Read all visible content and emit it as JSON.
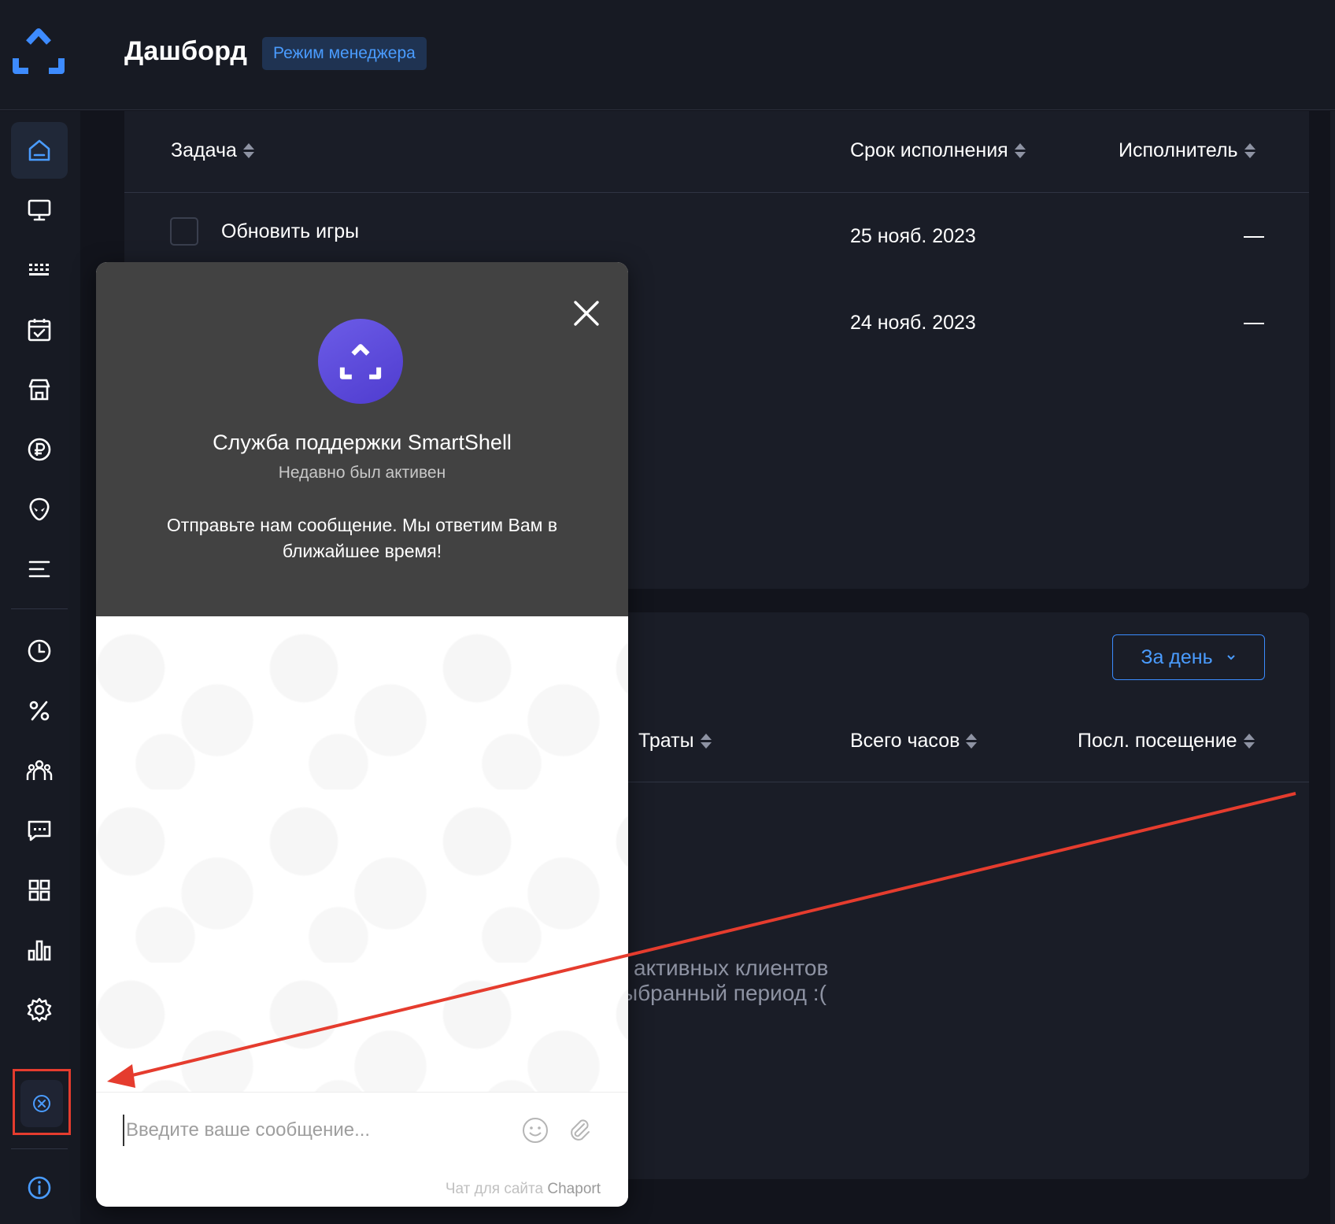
{
  "header": {
    "title": "Дашборд",
    "mode_badge": "Режим менеджера"
  },
  "sidebar": {
    "items": [
      {
        "icon": "home-icon",
        "active": true
      },
      {
        "icon": "monitor-icon"
      },
      {
        "icon": "keyboard-icon"
      },
      {
        "icon": "calendar-check-icon"
      },
      {
        "icon": "store-icon"
      },
      {
        "icon": "ruble-icon"
      },
      {
        "icon": "alien-icon"
      },
      {
        "icon": "menu-lines-icon"
      },
      {
        "icon": "clock-icon"
      },
      {
        "icon": "percent-icon"
      },
      {
        "icon": "users-icon"
      },
      {
        "icon": "chat-icon"
      },
      {
        "icon": "grid-icon"
      },
      {
        "icon": "bar-chart-icon"
      },
      {
        "icon": "gear-icon"
      },
      {
        "icon": "close-circle-icon"
      },
      {
        "icon": "info-icon"
      }
    ]
  },
  "tasks": {
    "columns": {
      "task": "Задача",
      "deadline": "Срок исполнения",
      "assignee": "Исполнитель"
    },
    "rows": [
      {
        "task": "Обновить игры",
        "deadline": "25 нояб. 2023",
        "assignee": "—"
      },
      {
        "task": "",
        "deadline": "24 нояб. 2023",
        "assignee": "—"
      }
    ]
  },
  "clients": {
    "period": "За день",
    "columns": {
      "spent": "Траты",
      "total_hours": "Всего часов",
      "last_visit": "Посл. посещение"
    },
    "empty_line1": "активных клиентов",
    "empty_line2": "ыбранный период :("
  },
  "chat": {
    "name": "Служба поддержки SmartShell",
    "status": "Недавно был активен",
    "greeting": "Отправьте нам сообщение. Мы ответим Вам в ближайшее время!",
    "input_placeholder": "Введите ваше сообщение...",
    "powered_prefix": "Чат для сайта",
    "powered_brand": "Chaport"
  },
  "colors": {
    "accent": "#4a9cff",
    "annotation": "#e53c2e",
    "chat_avatar": "#6c5ce7"
  }
}
